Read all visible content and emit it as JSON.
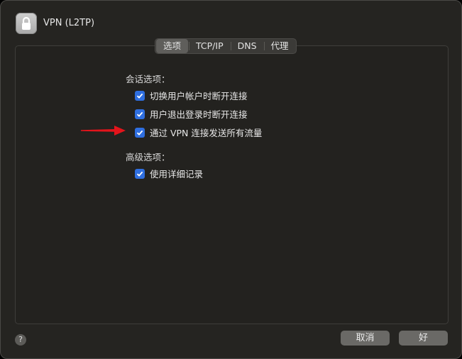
{
  "window": {
    "title": "VPN (L2TP)"
  },
  "tabs": [
    {
      "label": "选项",
      "selected": true
    },
    {
      "label": "TCP/IP",
      "selected": false
    },
    {
      "label": "DNS",
      "selected": false
    },
    {
      "label": "代理",
      "selected": false
    }
  ],
  "session": {
    "heading": "会话选项：",
    "options": [
      {
        "label": "切换用户帐户时断开连接",
        "checked": true
      },
      {
        "label": "用户退出登录时断开连接",
        "checked": true
      },
      {
        "label": "通过 VPN 连接发送所有流量",
        "checked": true
      }
    ]
  },
  "advanced": {
    "heading": "高级选项：",
    "options": [
      {
        "label": "使用详细记录",
        "checked": true
      }
    ]
  },
  "footer": {
    "help_label": "?",
    "cancel_label": "取消",
    "ok_label": "好"
  },
  "colors": {
    "checkbox": "#2f6fe0",
    "annotation_arrow": "#e3141b"
  }
}
